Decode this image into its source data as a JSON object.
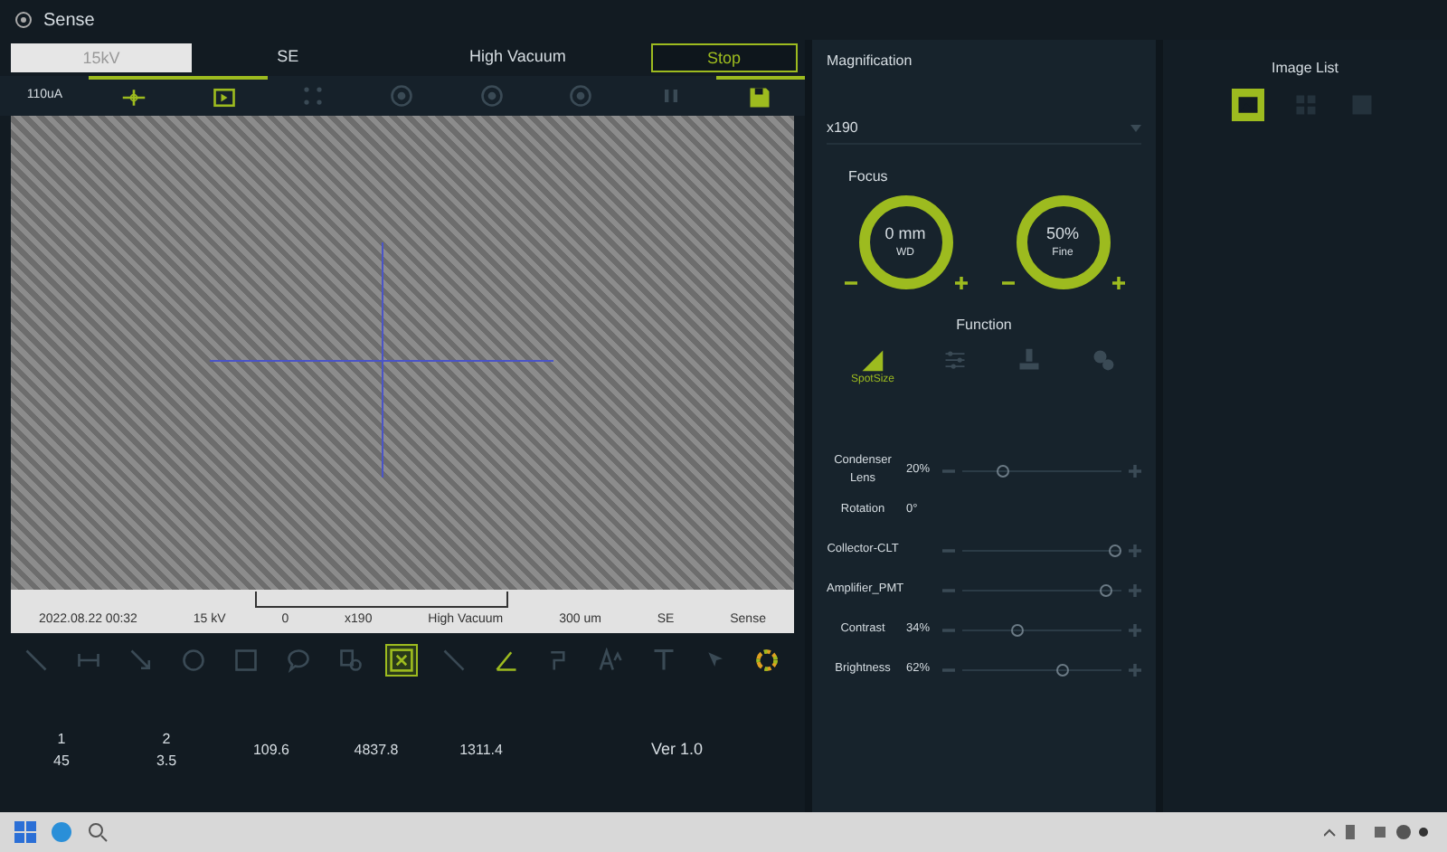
{
  "window": {
    "title": "Sense"
  },
  "top_bar": {
    "voltage_field": "15kV",
    "detector": "SE",
    "vacuum": "High Vacuum",
    "stop_button": "Stop",
    "current": "110uA"
  },
  "beam_tools": [
    {
      "kind": "crosshair",
      "active": true,
      "underlined": true
    },
    {
      "kind": "play",
      "active": true,
      "underlined": true
    },
    {
      "kind": "dots",
      "active": false,
      "underlined": false
    },
    {
      "kind": "target",
      "active": false,
      "underlined": false
    },
    {
      "kind": "target",
      "active": false,
      "underlined": false
    },
    {
      "kind": "target",
      "active": false,
      "underlined": false
    },
    {
      "kind": "pause",
      "active": false,
      "underlined": false
    },
    {
      "kind": "save",
      "active": true,
      "underlined": true
    }
  ],
  "image_info": {
    "timestamp": "2022.08.22 00:32",
    "voltage": "15 kV",
    "magnification": "x190",
    "vacuum": "High Vacuum",
    "detector": "SE",
    "scale_start": "0",
    "scale_length": "300 um",
    "brand": "Sense"
  },
  "annotation_tools": [
    {
      "kind": "line",
      "active": false,
      "selected": false
    },
    {
      "kind": "dimension",
      "active": false,
      "selected": false
    },
    {
      "kind": "arrow",
      "active": false,
      "selected": false
    },
    {
      "kind": "circle",
      "active": false,
      "selected": false
    },
    {
      "kind": "square",
      "active": false,
      "selected": false
    },
    {
      "kind": "bubble",
      "active": false,
      "selected": false
    },
    {
      "kind": "pin",
      "active": false,
      "selected": false
    },
    {
      "kind": "xbox",
      "active": true,
      "selected": true
    },
    {
      "kind": "line",
      "active": false,
      "selected": false
    },
    {
      "kind": "angle",
      "active": true,
      "selected": false
    },
    {
      "kind": "step",
      "active": false,
      "selected": false
    },
    {
      "kind": "textsize",
      "active": false,
      "selected": false
    },
    {
      "kind": "text",
      "active": false,
      "selected": false
    },
    {
      "kind": "cursor",
      "active": false,
      "selected": false
    },
    {
      "kind": "wheel",
      "active": true,
      "selected": false
    }
  ],
  "measurements": [
    {
      "values": [
        "1",
        "45"
      ]
    },
    {
      "values": [
        "2",
        "3.5"
      ]
    },
    {
      "values": [
        "109.6"
      ]
    },
    {
      "values": [
        "4837.8"
      ]
    },
    {
      "values": [
        "1311.4"
      ]
    }
  ],
  "version": "Ver 1.0",
  "magnification": {
    "title": "Magnification",
    "value": "x190"
  },
  "focus": {
    "title": "Focus",
    "knobs": [
      {
        "value": "0 mm",
        "label": "WD"
      },
      {
        "value": "50%",
        "label": "Fine"
      }
    ]
  },
  "function": {
    "title": "Function",
    "items": [
      {
        "kind": "spotsize",
        "label": "SpotSize",
        "selected": true
      },
      {
        "kind": "sliders",
        "selected": false
      },
      {
        "kind": "stamp",
        "selected": false
      },
      {
        "kind": "gears",
        "selected": false
      }
    ]
  },
  "sliders": [
    {
      "label": "Condenser Lens",
      "reading": "20%",
      "level": 0.25
    },
    {
      "label": "Rotation",
      "reading": "0°"
    },
    {
      "label": "Collector-CLT",
      "level": 0.96
    },
    {
      "label": "Amplifier_PMT",
      "level": 0.9
    },
    {
      "label": "Contrast",
      "reading": "34%",
      "level": 0.34
    },
    {
      "label": "Brightness",
      "reading": "62%",
      "level": 0.62
    }
  ],
  "image_list": {
    "title": "Image List",
    "views": [
      {
        "kind": "image",
        "selected": true
      },
      {
        "kind": "grid",
        "selected": false
      },
      {
        "kind": "block",
        "selected": false
      }
    ]
  }
}
